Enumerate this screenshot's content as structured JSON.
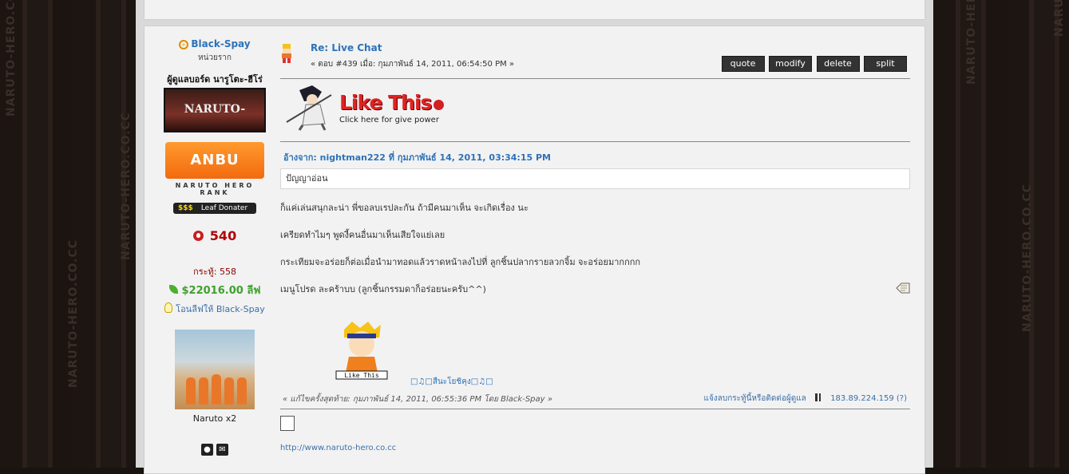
{
  "background": {
    "side_text": "NARUTO-HERO.CO.CC"
  },
  "poster": {
    "name": "Black-Spay",
    "position": "หน่วยราก",
    "staff_title": "ผู้ดูแลบอร์ด  นารูโตะ-ฮีโร่",
    "banner1_text": "NARUTO-HERO",
    "banner2_text": "ANBU",
    "rank_line": "NARUTO HERO RANK",
    "donor_dollars": "$$$",
    "donor_label": "Leaf Donater",
    "power": "540",
    "posts_label": "กระทู้: 558",
    "money": "$22016.00 ลีฟ",
    "gift_link": "โอนลีฟให้ Black-Spay",
    "avatar_caption": "Naruto x2"
  },
  "post": {
    "title": "Re: Live Chat",
    "meta": "« ตอบ #439 เมื่อ: กุมภาพันธ์ 14, 2011, 06:54:50 PM »",
    "buttons": [
      "quote",
      "modify",
      "delete",
      "split"
    ],
    "like_title": "Like This",
    "like_sub": "Click here for give power",
    "quote_header": "อ้างจาก: nightman222 ที่ กุมภาพันธ์ 14, 2011, 03:34:15 PM",
    "quote_body": "ปัญญาอ่อน",
    "lines": [
      "ก็แค่เล่นสนุกละน่า พี่ขอลบเรปละกัน ถ้ามีคนมาเห็น จะเกิดเรื่อง  นะ",
      "เครียดทำไมๆ พูดงี้คนอื่นมาเห็นเสียใจแย่เลย",
      "กระเทียมจะอร่อยก็ต่อเมื่อนำมาทอดแล้วราดหน้าลงไปที่ ลูกชิ้นปลากรายลวกจิ้ม จะอร่อยมากกกก",
      "เมนูโปรด ละคร้าบบ (ลูกชิ้นกรรมดาก็อร่อยนะครับ^^)"
    ],
    "naruto_like_label": "Like This",
    "naruto_text": "□♫□สืนะโยชิคุง□♫□",
    "last_edit": "« แก้ไขครั้งสุดท้าย: กุมภาพันธ์ 14, 2011, 06:55:36 PM โดย Black-Spay »",
    "report": "แจ้งลบกระทู้นี้หรือติดต่อผู้ดูแล",
    "ip": "183.89.224.159 (?)",
    "signature_link": "http://www.naruto-hero.co.cc"
  }
}
